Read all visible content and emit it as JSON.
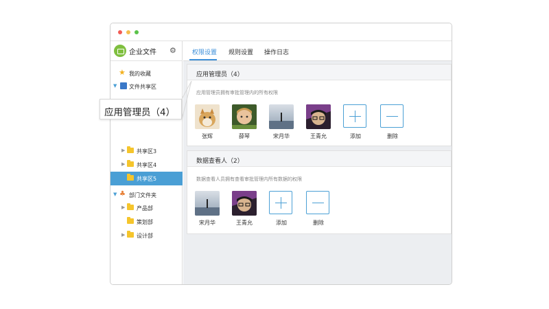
{
  "sidebar": {
    "app_title": "企业文件",
    "settings_icon": "gear-icon",
    "items": [
      {
        "label": "我的收藏",
        "icon": "star-icon"
      },
      {
        "label": "文件共享区",
        "icon": "shared-folder-icon"
      },
      {
        "label": "共享区3",
        "icon": "folder-icon"
      },
      {
        "label": "共享区4",
        "icon": "folder-icon"
      },
      {
        "label": "共享区5",
        "icon": "folder-icon",
        "selected": true
      },
      {
        "label": "部门文件夹",
        "icon": "department-icon"
      },
      {
        "label": "产品部",
        "icon": "folder-icon"
      },
      {
        "label": "策划部",
        "icon": "folder-icon"
      },
      {
        "label": "设计部",
        "icon": "folder-icon"
      }
    ]
  },
  "tabs": [
    {
      "label": "权限设置",
      "active": true
    },
    {
      "label": "规则设置"
    },
    {
      "label": "操作日志"
    }
  ],
  "panels": [
    {
      "title": "应用管理员（4）",
      "description": "应用管理员拥有审批管理内的所有权限",
      "members": [
        "张辉",
        "薛琴",
        "宋月华",
        "王青允"
      ],
      "add_label": "添加",
      "remove_label": "删除"
    },
    {
      "title": "数据查看人（2）",
      "description": "数据查看人员拥有查看审批管理内所有数据的权限",
      "members": [
        "宋月华",
        "王青允"
      ],
      "add_label": "添加",
      "remove_label": "删除"
    }
  ],
  "callout": {
    "text": "应用管理员（4）"
  },
  "colors": {
    "accent": "#4a9fd5",
    "tab_active": "#3c8fd9",
    "selected_row": "#4a9fd5",
    "logo": "#7fbf3f"
  }
}
